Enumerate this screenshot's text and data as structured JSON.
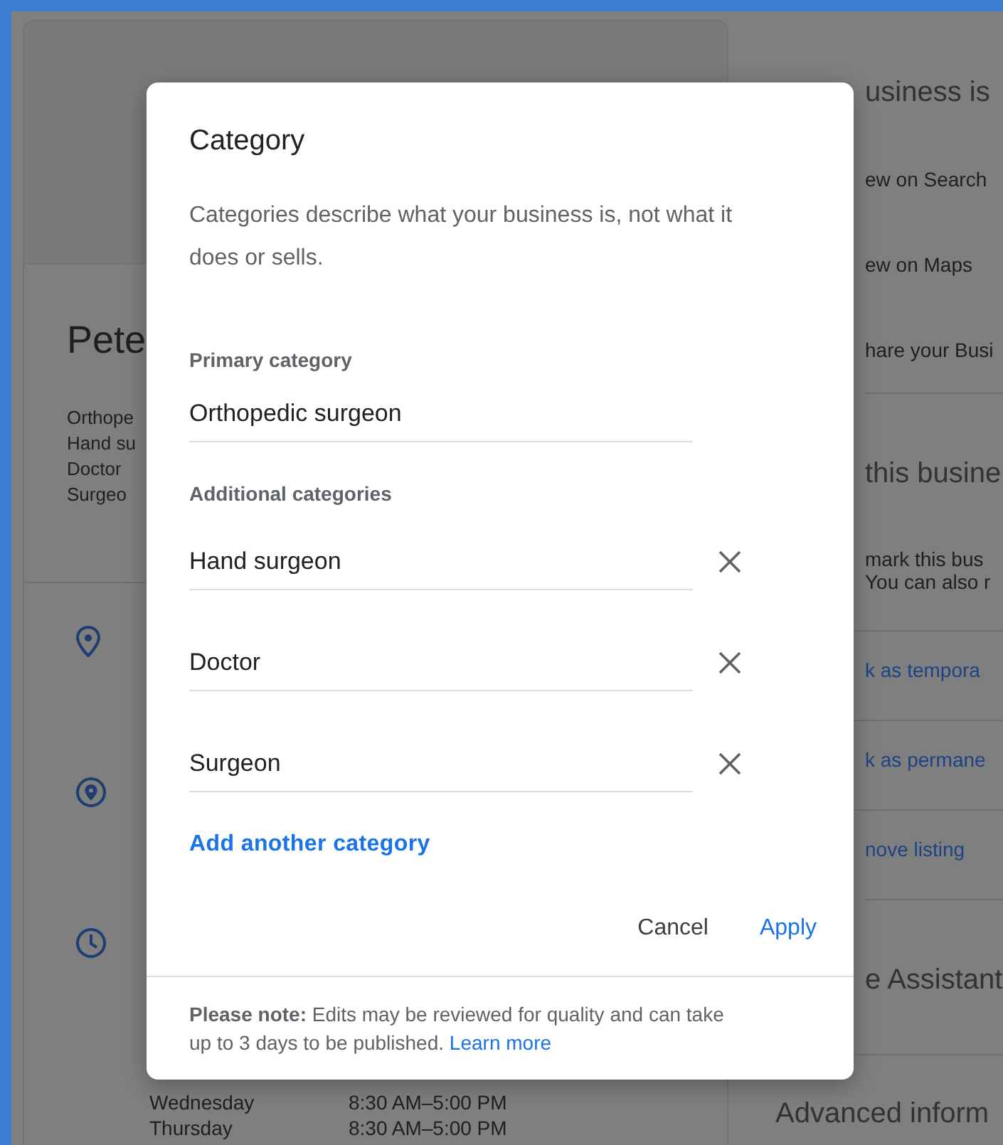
{
  "background": {
    "left_card": {
      "name": "Pete",
      "categories": [
        "Orthope",
        "Hand su",
        "Doctor",
        "Surgeo"
      ],
      "hours": [
        {
          "day": "Wednesday",
          "time": "8:30 AM–5:00 PM"
        },
        {
          "day": "Thursday",
          "time": "8:30 AM–5:00 PM"
        }
      ]
    },
    "right_column": [
      {
        "kind": "heading",
        "text": "usiness is"
      },
      {
        "kind": "item",
        "text": "ew on Search"
      },
      {
        "kind": "item",
        "text": "ew on Maps"
      },
      {
        "kind": "item",
        "text": "hare your Busi"
      },
      {
        "kind": "heading",
        "text": "this busine"
      },
      {
        "kind": "para",
        "lines": [
          "mark this bus",
          "You can also r"
        ]
      },
      {
        "kind": "link",
        "text": "k as tempora"
      },
      {
        "kind": "link",
        "text": "k as permane"
      },
      {
        "kind": "link",
        "text": "nove listing"
      },
      {
        "kind": "heading",
        "text": "e Assistant"
      },
      {
        "kind": "heading",
        "text": "Advanced inform"
      }
    ]
  },
  "dialog": {
    "title": "Category",
    "description": "Categories describe what your business is, not what it does or sells.",
    "primary_label": "Primary category",
    "primary_value": "Orthopedic surgeon",
    "additional_label": "Additional categories",
    "additional": [
      {
        "value": "Hand surgeon"
      },
      {
        "value": "Doctor"
      },
      {
        "value": "Surgeon"
      }
    ],
    "add_link": "Add another category",
    "buttons": [
      "Cancel",
      "Apply"
    ],
    "note": "**Please note:** Edits may be reviewed for quality and can take up to 3 days to be published.",
    "note_link": "Learn more"
  }
}
